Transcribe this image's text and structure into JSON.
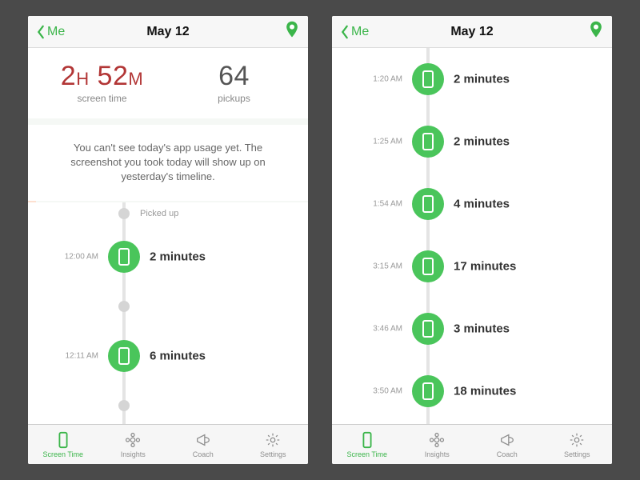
{
  "header": {
    "back_label": "Me",
    "title": "May 12"
  },
  "summary": {
    "screen_time_value": "2",
    "screen_time_unit1": "H",
    "screen_time_value2": "52",
    "screen_time_unit2": "M",
    "screen_time_label": "screen time",
    "pickups_value": "64",
    "pickups_label": "pickups"
  },
  "info": {
    "text": "You can't see today's app usage yet. The screenshot you took today will show up on yesterday's timeline."
  },
  "picked_up_label": "Picked up",
  "left_timeline": [
    {
      "time": "12:00 AM",
      "duration": "2 minutes"
    },
    {
      "time": "12:11 AM",
      "duration": "6 minutes"
    }
  ],
  "right_timeline": [
    {
      "time": "1:20 AM",
      "duration": "2 minutes"
    },
    {
      "time": "1:25 AM",
      "duration": "2 minutes"
    },
    {
      "time": "1:54 AM",
      "duration": "4 minutes"
    },
    {
      "time": "3:15 AM",
      "duration": "17 minutes"
    },
    {
      "time": "3:46 AM",
      "duration": "3 minutes"
    },
    {
      "time": "3:50 AM",
      "duration": "18 minutes"
    }
  ],
  "tabs": {
    "screen_time": "Screen Time",
    "insights": "Insights",
    "coach": "Coach",
    "settings": "Settings"
  },
  "colors": {
    "accent": "#3bb54a",
    "dot": "#4ac55b",
    "red": "#b23636"
  }
}
